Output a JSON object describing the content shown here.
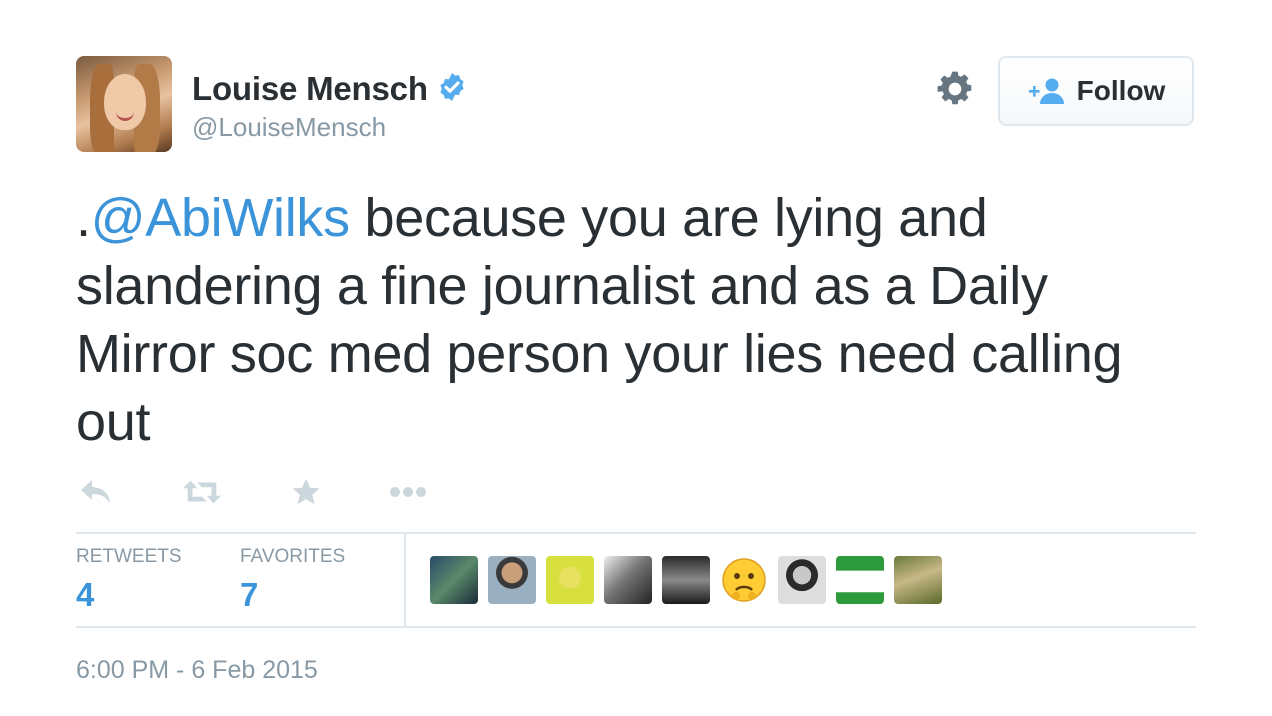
{
  "user": {
    "display_name": "Louise Mensch",
    "screen_name": "@LouiseMensch",
    "verified_icon": "verified-badge-icon",
    "avatar": "profile-avatar"
  },
  "header": {
    "settings_icon": "gear-icon",
    "follow_label": "Follow",
    "follow_icon": "follow-user-icon"
  },
  "tweet": {
    "prefix": ".",
    "mention": "@AbiWilks",
    "text": " because you are lying and slandering a fine journalist and as a Daily Mirror soc med person your lies need calling out"
  },
  "actions": {
    "reply_icon": "reply-icon",
    "retweet_icon": "retweet-icon",
    "favorite_icon": "star-icon",
    "more_icon": "more-icon"
  },
  "stats": {
    "retweets_label": "RETWEETS",
    "retweets_count": "4",
    "favorites_label": "FAVORITES",
    "favorites_count": "7"
  },
  "favoriters": [
    "user-avatar",
    "user-avatar",
    "user-avatar",
    "user-avatar",
    "user-avatar",
    "emoji-avatar",
    "user-avatar",
    "user-avatar",
    "user-avatar"
  ],
  "timestamp": "6:00 PM - 6 Feb 2015",
  "colors": {
    "link": "#3b94d9",
    "text": "#292f33",
    "muted": "#8899a6",
    "border": "#e1e8ed",
    "verified": "#55acee"
  }
}
